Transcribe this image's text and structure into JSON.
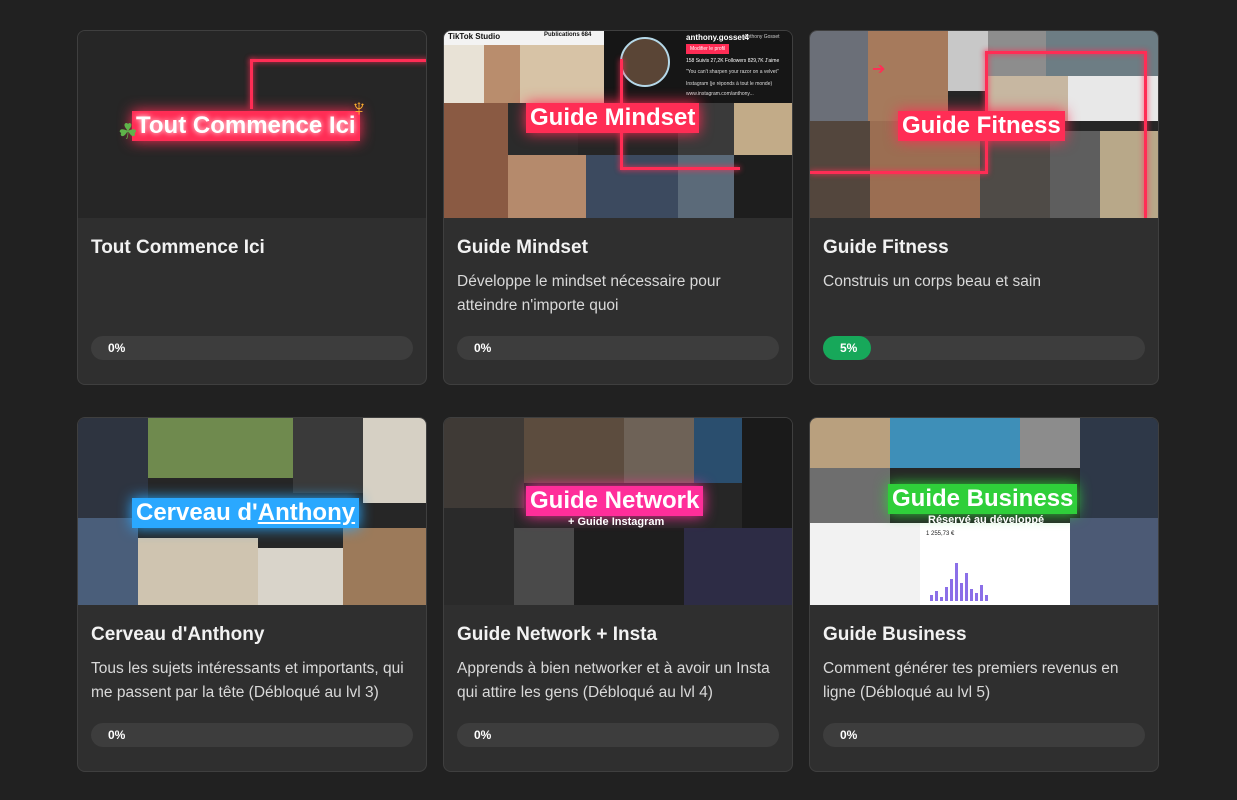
{
  "colors": {
    "background": "#212121",
    "card": "#2f2f2f",
    "progress_track": "#3d3d3d",
    "progress_active": "#17a85a",
    "neon_pink": "#ff2d55",
    "neon_blue": "#2aa8ff",
    "neon_magenta": "#ff2e9a",
    "neon_green": "#2fcf3a"
  },
  "courses": [
    {
      "thumb_text": "Tout Commence Ici",
      "title": "Tout Commence Ici",
      "description": "",
      "progress": 0,
      "progress_label": "0%"
    },
    {
      "thumb_text": "Guide Mindset",
      "thumb_header_left": "TikTok Studio",
      "thumb_header_mid": "Publications 684",
      "thumb_header_user": "anthony.gosset4",
      "thumb_header_name": "Anthony Gosset",
      "thumb_header_button": "Modifier le profil",
      "thumb_stats": "158 Suivis   27,2K Followers   829,7K J'aime",
      "thumb_quote": "\"You can't sharpen your razor on a velvet\"",
      "thumb_link1": "Instagram (je réponds à tout le monde)",
      "thumb_link2": "www.instagram.com/anthony...",
      "title": "Guide Mindset",
      "description": "Développe le mindset nécessaire pour atteindre n'importe quoi",
      "progress": 0,
      "progress_label": "0%"
    },
    {
      "thumb_text": "Guide Fitness",
      "title": "Guide Fitness",
      "description": "Construis un corps beau et sain",
      "progress": 0.05,
      "progress_label": "5%"
    },
    {
      "thumb_text_prefix": "Cerveau d'",
      "thumb_text_suffix": "Anthony",
      "title": "Cerveau d'Anthony",
      "description": "Tous les sujets intéressants et importants, qui me passent par la tête (Débloqué au lvl 3)",
      "progress": 0,
      "progress_label": "0%"
    },
    {
      "thumb_text": "Guide Network",
      "thumb_subtext": "+  Guide Instagram",
      "title": "Guide Network + Insta",
      "description": "Apprends à bien networker et à avoir un Insta qui attire les gens (Débloqué au lvl 4)",
      "progress": 0,
      "progress_label": "0%"
    },
    {
      "thumb_text": "Guide Business",
      "thumb_subtext": "Réservé au développé",
      "thumb_amount": "1 255,73 €",
      "title": "Guide Business",
      "description": "Comment générer tes premiers revenus en ligne (Débloqué au lvl 5)",
      "progress": 0,
      "progress_label": "0%"
    }
  ]
}
